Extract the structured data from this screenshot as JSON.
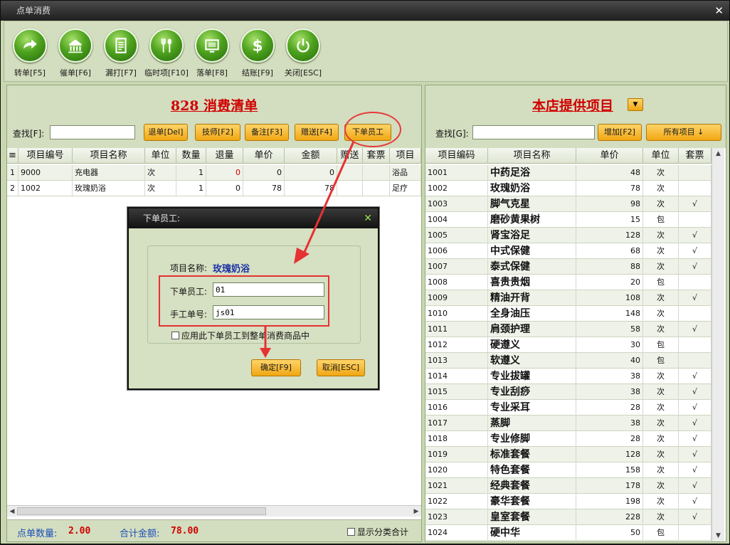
{
  "window": {
    "title": "点单消费"
  },
  "toolbar": [
    {
      "label": "转单[F5]",
      "icon": "forward-arrow-icon"
    },
    {
      "label": "催单[F6]",
      "icon": "bell-icon"
    },
    {
      "label": "漏打[F7]",
      "icon": "document-icon"
    },
    {
      "label": "临时项[F10]",
      "icon": "fork-spoon-icon"
    },
    {
      "label": "落单[F8]",
      "icon": "monitor-icon"
    },
    {
      "label": "结账[F9]",
      "icon": "dollar-icon"
    },
    {
      "label": "关闭[ESC]",
      "icon": "power-icon"
    }
  ],
  "bill": {
    "title": "828 消费清单",
    "search_label": "查找[F]:",
    "search_value": "",
    "buttons": [
      "退单[Del]",
      "技师[F2]",
      "备注[F3]",
      "赠送[F4]",
      "下单员工"
    ],
    "columns": [
      "项目编号",
      "项目名称",
      "单位",
      "数量",
      "退量",
      "单价",
      "金额",
      "赠送",
      "套票",
      "项目"
    ],
    "rows": [
      {
        "idx": "1",
        "code": "9000",
        "name": "充电器",
        "unit": "次",
        "qty": "1",
        "ret": "0",
        "price": "0",
        "amount": "0",
        "gift": "",
        "ticket": "",
        "cat": "浴品"
      },
      {
        "idx": "2",
        "code": "1002",
        "name": "玫瑰奶浴",
        "unit": "次",
        "qty": "1",
        "ret": "0",
        "price": "78",
        "amount": "78",
        "gift": "",
        "ticket": "",
        "cat": "足疗"
      }
    ],
    "footer": {
      "count_label": "点单数量:",
      "count_value": "2.00",
      "total_label": "合计金额:",
      "total_value": "78.00",
      "show_category_label": "显示分类合计"
    }
  },
  "catalog": {
    "title": "本店提供项目",
    "search_label": "查找[G]:",
    "search_value": "",
    "add_label": "增加[F2]",
    "filter_label": "所有项目 ↓",
    "columns": [
      "项目编码",
      "项目名称",
      "单价",
      "单位",
      "套票"
    ],
    "items": [
      {
        "code": "1001",
        "name": "中药足浴",
        "price": "48",
        "unit": "次",
        "ticket": ""
      },
      {
        "code": "1002",
        "name": "玫瑰奶浴",
        "price": "78",
        "unit": "次",
        "ticket": ""
      },
      {
        "code": "1003",
        "name": "脚气克星",
        "price": "98",
        "unit": "次",
        "ticket": "√"
      },
      {
        "code": "1004",
        "name": "磨砂黄果树",
        "price": "15",
        "unit": "包",
        "ticket": ""
      },
      {
        "code": "1005",
        "name": "肾宝浴足",
        "price": "128",
        "unit": "次",
        "ticket": "√"
      },
      {
        "code": "1006",
        "name": "中式保健",
        "price": "68",
        "unit": "次",
        "ticket": "√"
      },
      {
        "code": "1007",
        "name": "泰式保健",
        "price": "88",
        "unit": "次",
        "ticket": "√"
      },
      {
        "code": "1008",
        "name": "喜贵贵烟",
        "price": "20",
        "unit": "包",
        "ticket": ""
      },
      {
        "code": "1009",
        "name": "精油开背",
        "price": "108",
        "unit": "次",
        "ticket": "√"
      },
      {
        "code": "1010",
        "name": "全身油压",
        "price": "148",
        "unit": "次",
        "ticket": ""
      },
      {
        "code": "1011",
        "name": "肩颈护理",
        "price": "58",
        "unit": "次",
        "ticket": "√"
      },
      {
        "code": "1012",
        "name": "硬遵义",
        "price": "30",
        "unit": "包",
        "ticket": ""
      },
      {
        "code": "1013",
        "name": "软遵义",
        "price": "40",
        "unit": "包",
        "ticket": ""
      },
      {
        "code": "1014",
        "name": "专业拔罐",
        "price": "38",
        "unit": "次",
        "ticket": "√"
      },
      {
        "code": "1015",
        "name": "专业刮痧",
        "price": "38",
        "unit": "次",
        "ticket": "√"
      },
      {
        "code": "1016",
        "name": "专业采耳",
        "price": "28",
        "unit": "次",
        "ticket": "√"
      },
      {
        "code": "1017",
        "name": "蒸脚",
        "price": "38",
        "unit": "次",
        "ticket": "√"
      },
      {
        "code": "1018",
        "name": "专业修脚",
        "price": "28",
        "unit": "次",
        "ticket": "√"
      },
      {
        "code": "1019",
        "name": "标准套餐",
        "price": "128",
        "unit": "次",
        "ticket": "√"
      },
      {
        "code": "1020",
        "name": "特色套餐",
        "price": "158",
        "unit": "次",
        "ticket": "√"
      },
      {
        "code": "1021",
        "name": "经典套餐",
        "price": "178",
        "unit": "次",
        "ticket": "√"
      },
      {
        "code": "1022",
        "name": "豪华套餐",
        "price": "198",
        "unit": "次",
        "ticket": "√"
      },
      {
        "code": "1023",
        "name": "皇室套餐",
        "price": "228",
        "unit": "次",
        "ticket": "√"
      },
      {
        "code": "1024",
        "name": "硬中华",
        "price": "50",
        "unit": "包",
        "ticket": ""
      }
    ]
  },
  "dialog": {
    "title": "下单员工:",
    "item_name_label": "项目名称:",
    "item_name_value": "玫瑰奶浴",
    "staff_label": "下单员工:",
    "staff_value": "01",
    "manual_no_label": "手工单号:",
    "manual_no_value": "js01",
    "apply_all_label": "应用此下单员工到整单消费商品中",
    "ok_label": "确定[F9]",
    "cancel_label": "取消[ESC]"
  },
  "colors": {
    "background": "#c9d7b0",
    "accent_orange": "#f0a713",
    "title_red": "#d10000",
    "annotation_red": "#e53232",
    "link_blue": "#1d4fb8"
  }
}
